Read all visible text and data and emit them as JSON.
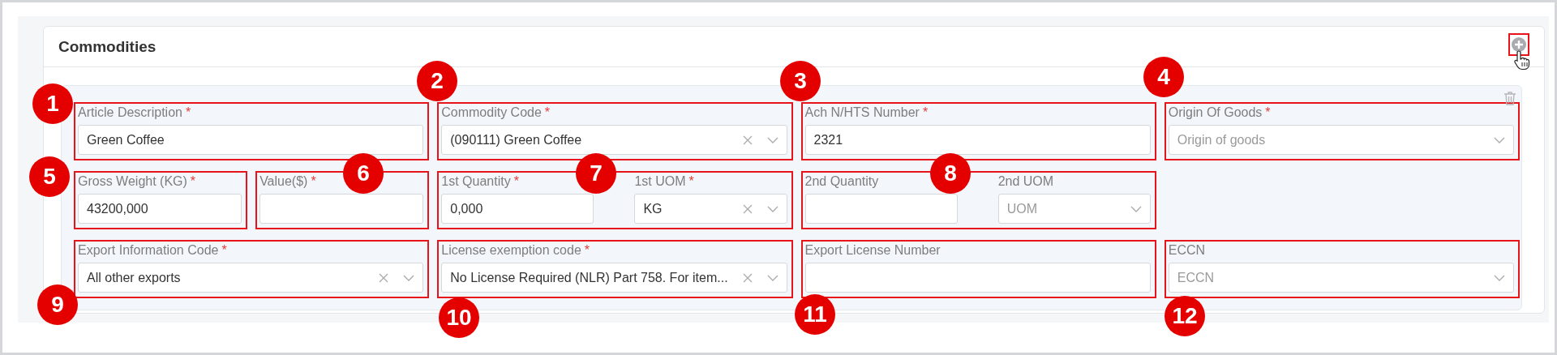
{
  "section": {
    "title": "Commodities",
    "add_button": {
      "highlighted": true
    }
  },
  "rows": [
    {
      "groups": [
        {
          "highlighted": true,
          "fields": [
            {
              "kind": "input",
              "label": "Article Description",
              "required_mark": "*",
              "value": "Green Coffee"
            }
          ]
        },
        {
          "highlighted": true,
          "fields": [
            {
              "kind": "select",
              "label": "Commodity Code",
              "required_mark": "*",
              "value": "(090111) Green Coffee",
              "clearable": true
            }
          ]
        },
        {
          "highlighted": true,
          "fields": [
            {
              "kind": "input",
              "label": "Ach N/HTS Number",
              "required_mark": "*",
              "value": "2321"
            }
          ]
        },
        {
          "highlighted": true,
          "fields": [
            {
              "kind": "select",
              "label": "Origin Of Goods",
              "required_mark": "*",
              "placeholder": "Origin of goods",
              "clearable": false
            }
          ]
        }
      ]
    },
    {
      "groups": [
        {
          "highlighted": true,
          "fields": [
            {
              "kind": "input",
              "label": "Gross Weight (KG)",
              "required_mark": "*",
              "value": "43200,000"
            }
          ]
        },
        {
          "highlighted": true,
          "fields": [
            {
              "kind": "input",
              "label": "Value($)",
              "required_mark": "*"
            }
          ]
        },
        {
          "highlighted": true,
          "fields": [
            {
              "kind": "input",
              "label": "1st Quantity",
              "required_mark": "*",
              "value": "0,000"
            },
            {
              "kind": "select",
              "label": "1st UOM",
              "required_mark": "*",
              "value": "KG",
              "clearable": true
            }
          ]
        },
        {
          "highlighted": true,
          "fields": [
            {
              "kind": "input",
              "label": "2nd Quantity"
            },
            {
              "kind": "select",
              "label": "2nd UOM",
              "placeholder": "UOM",
              "clearable": false
            }
          ]
        }
      ]
    },
    {
      "groups": [
        {
          "highlighted": true,
          "fields": [
            {
              "kind": "select",
              "label": "Export Information Code",
              "required_mark": "*",
              "value": "All other exports",
              "clearable": true
            }
          ]
        },
        {
          "highlighted": true,
          "fields": [
            {
              "kind": "select",
              "label": "License exemption code",
              "required_mark": "*",
              "value": "No License Required (NLR) Part 758. For item...",
              "clearable": true
            }
          ]
        },
        {
          "highlighted": true,
          "fields": [
            {
              "kind": "input",
              "label": "Export License Number"
            }
          ]
        },
        {
          "highlighted": true,
          "fields": [
            {
              "kind": "select",
              "label": "ECCN",
              "placeholder": "ECCN",
              "clearable": false
            }
          ]
        }
      ]
    }
  ],
  "badges": [
    "1",
    "2",
    "3",
    "4",
    "5",
    "6",
    "7",
    "8",
    "9",
    "10",
    "11",
    "12"
  ]
}
